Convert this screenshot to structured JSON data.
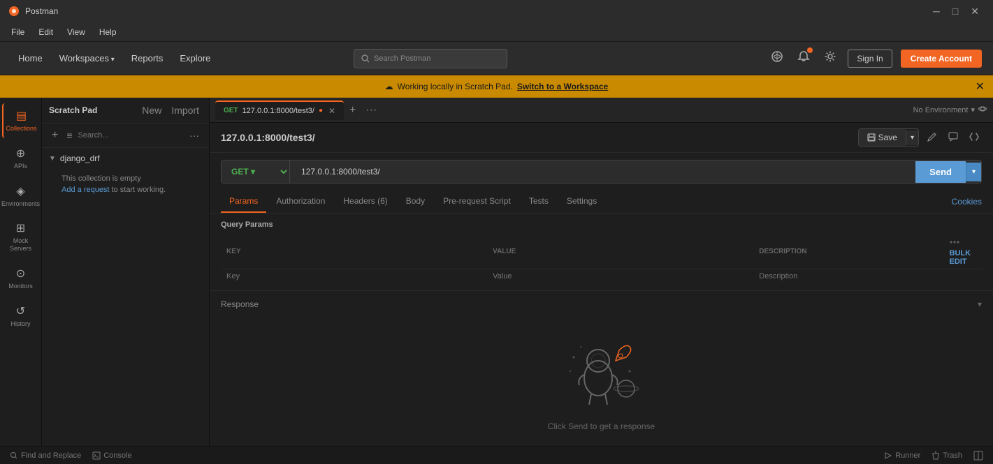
{
  "app": {
    "title": "Postman",
    "icon": "🟠"
  },
  "titlebar": {
    "minimize": "─",
    "maximize": "□",
    "close": "✕"
  },
  "menubar": {
    "items": [
      "File",
      "Edit",
      "View",
      "Help"
    ]
  },
  "topbar": {
    "nav": [
      "Home",
      "Workspaces",
      "Reports",
      "Explore"
    ],
    "search_placeholder": "Search Postman",
    "sign_in": "Sign In",
    "create_account": "Create Account"
  },
  "banner": {
    "icon": "☁",
    "text": "Working locally in Scratch Pad.",
    "link_text": "Switch to a Workspace"
  },
  "sidebar": {
    "panel_title": "Scratch Pad",
    "new_label": "New",
    "import_label": "Import",
    "icons": [
      {
        "name": "collections",
        "icon": "▤",
        "label": "Collections"
      },
      {
        "name": "apis",
        "icon": "⊕",
        "label": "APIs"
      },
      {
        "name": "environments",
        "icon": "◈",
        "label": "Environments"
      },
      {
        "name": "mock-servers",
        "icon": "⊞",
        "label": "Mock Servers"
      },
      {
        "name": "monitors",
        "icon": "⊙",
        "label": "Monitors"
      },
      {
        "name": "history",
        "icon": "↺",
        "label": "History"
      }
    ],
    "collection": {
      "name": "django_drf",
      "empty_text": "This collection is empty",
      "add_link": "Add a request",
      "add_suffix": " to start working."
    }
  },
  "tabs": {
    "active": {
      "method": "GET",
      "url": "127.0.0.1:8000/test3/",
      "has_dot": true
    },
    "more_icon": "···",
    "env_label": "No Environment"
  },
  "request": {
    "name": "127.0.0.1:8000/test3/",
    "save_label": "Save",
    "method": "GET",
    "url": "127.0.0.1:8000/test3/",
    "send_label": "Send",
    "tabs": [
      "Params",
      "Authorization",
      "Headers (6)",
      "Body",
      "Pre-request Script",
      "Tests",
      "Settings"
    ],
    "active_tab": "Params",
    "cookies_link": "Cookies",
    "query_params_title": "Query Params",
    "table": {
      "headers": [
        "KEY",
        "VALUE",
        "DESCRIPTION"
      ],
      "key_placeholder": "Key",
      "value_placeholder": "Value",
      "desc_placeholder": "Description"
    },
    "bulk_edit": "Bulk Edit"
  },
  "response": {
    "title": "Response",
    "hint": "Click Send to get a response"
  },
  "statusbar": {
    "find_replace": "Find and Replace",
    "console": "Console",
    "runner": "Runner",
    "trash": "Trash"
  }
}
